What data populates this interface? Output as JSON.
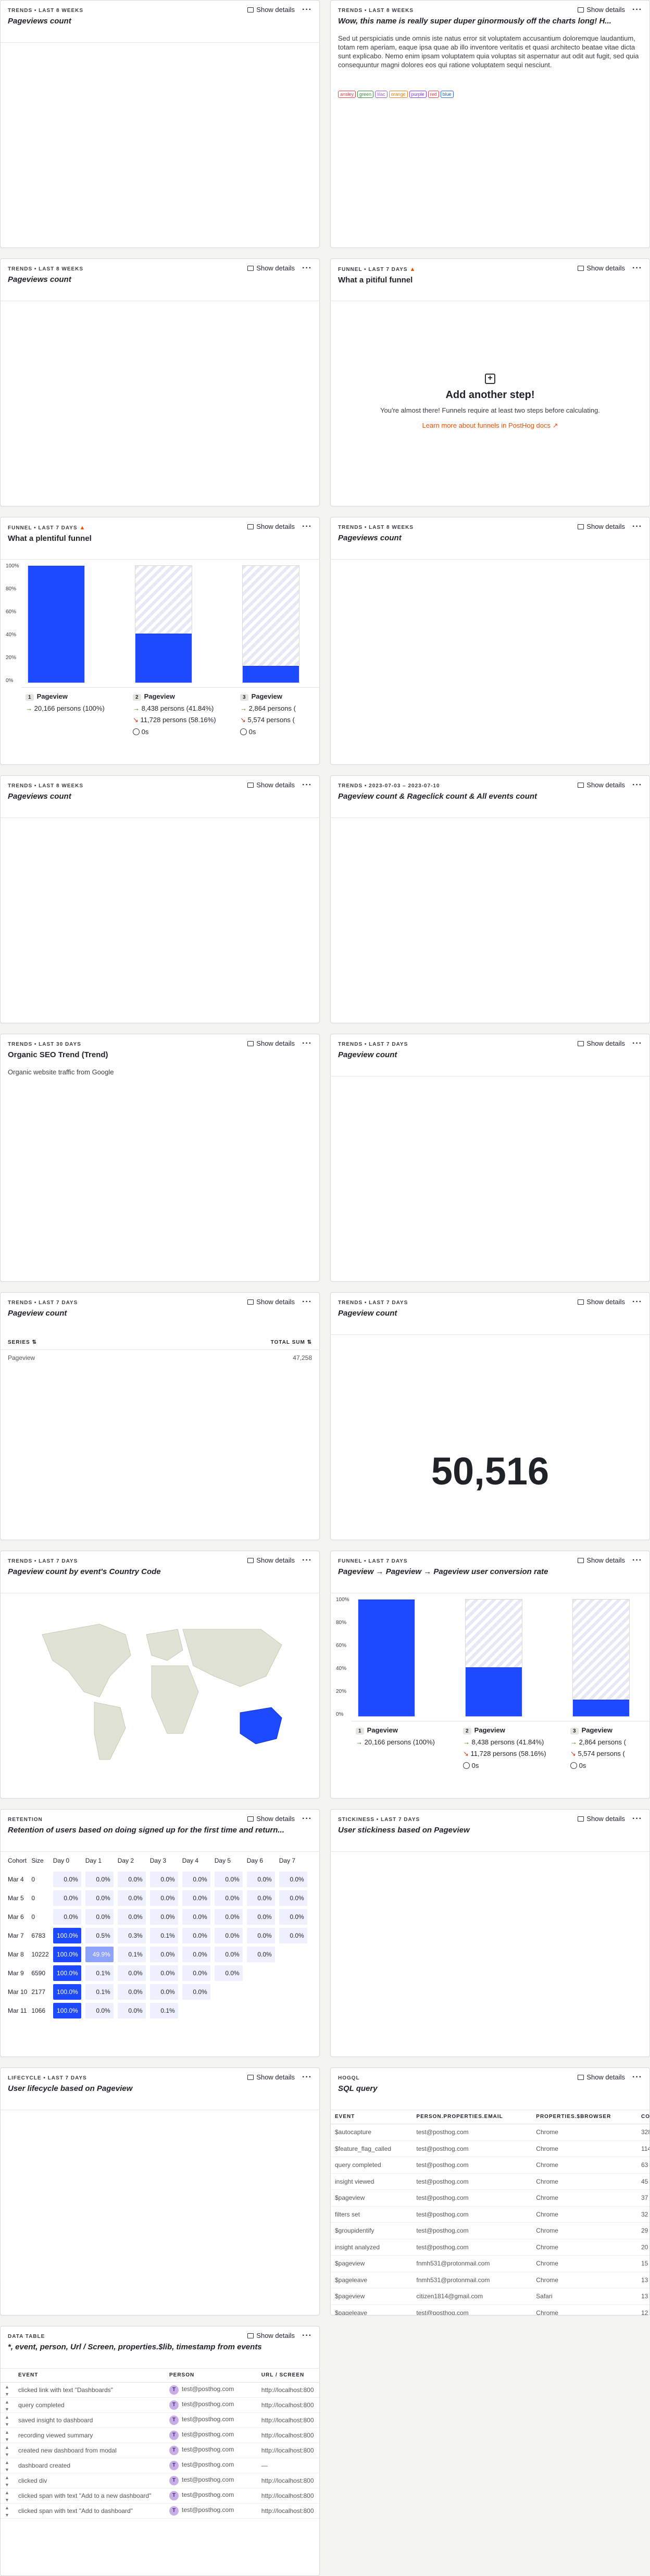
{
  "ui": {
    "show_details": "Show details",
    "more": "···"
  },
  "cards": {
    "c1": {
      "meta": "TRENDS • LAST 8 WEEKS",
      "title": "Pageviews count"
    },
    "c2": {
      "meta": "TRENDS • LAST 8 WEEKS",
      "title": "Wow, this name is really super duper ginormously off the charts long! H...",
      "desc": "Sed ut perspiciatis unde omnis iste natus error sit voluptatem accusantium doloremque laudantium, totam rem aperiam, eaque ipsa quae ab illo inventore veritatis et quasi architecto beatae vitae dicta sunt explicabo. Nemo enim ipsam voluptatem quia voluptas sit aspernatur aut odit aut fugit, sed quia consequuntur magni dolores eos qui ratione voluptatem sequi nesciunt.",
      "tags": [
        {
          "label": "ansley",
          "color": "#e0424b"
        },
        {
          "label": "green",
          "color": "#3a8a3a"
        },
        {
          "label": "lilac",
          "color": "#a15ec9"
        },
        {
          "label": "orange",
          "color": "#e8811d"
        },
        {
          "label": "purple",
          "color": "#7c3aed"
        },
        {
          "label": "red",
          "color": "#e0424b"
        },
        {
          "label": "blue",
          "color": "#2d62d8"
        }
      ]
    },
    "c3": {
      "meta": "TRENDS • LAST 8 WEEKS",
      "title": "Pageviews count"
    },
    "c4": {
      "meta": "FUNNEL • LAST 7 DAYS",
      "title": "What a pitiful funnel",
      "empty_title": "Add another step!",
      "empty_text": "You're almost there! Funnels require at least two steps before calculating.",
      "empty_link": "Learn more about funnels in PostHog docs"
    },
    "c5": {
      "meta": "FUNNEL • LAST 7 DAYS",
      "title": "What a plentiful funnel"
    },
    "c6": {
      "meta": "TRENDS • LAST 8 WEEKS",
      "title": "Pageviews count"
    },
    "c7": {
      "meta": "TRENDS • LAST 8 WEEKS",
      "title": "Pageviews count"
    },
    "c8": {
      "meta": "TRENDS • 2023-07-03 – 2023-07-10",
      "title": "Pageview count & Rageclick count & All events count"
    },
    "c9": {
      "meta": "TRENDS • LAST 30 DAYS",
      "title": "Organic SEO Trend (Trend)",
      "desc": "Organic website traffic from Google"
    },
    "c10": {
      "meta": "TRENDS • LAST 7 DAYS",
      "title": "Pageview count"
    },
    "c11": {
      "meta": "TRENDS • LAST 7 DAYS",
      "title": "Pageview count",
      "col_series": "SERIES",
      "col_total": "TOTAL SUM",
      "row_label": "Pageview",
      "row_value": "47,258"
    },
    "c12": {
      "meta": "TRENDS • LAST 7 DAYS",
      "title": "Pageview count",
      "big_number": "50,516"
    },
    "c13": {
      "meta": "TRENDS • LAST 7 DAYS",
      "title": "Pageview count by event's Country Code"
    },
    "c14": {
      "meta": "FUNNEL • LAST 7 DAYS",
      "title": "Pageview → Pageview → Pageview user conversion rate"
    },
    "c15": {
      "meta": "RETENTION",
      "title": "Retention of users based on doing signed up for the first time and return..."
    },
    "c16": {
      "meta": "STICKINESS • LAST 7 DAYS",
      "title": "User stickiness based on Pageview"
    },
    "c17": {
      "meta": "LIFECYCLE • LAST 7 DAYS",
      "title": "User lifecycle based on Pageview"
    },
    "c18": {
      "meta": "HOGQL",
      "title": "SQL query"
    },
    "c19": {
      "meta": "DATA TABLE",
      "title": "*, event, person, Url / Screen, properties.$lib, timestamp from events"
    }
  },
  "funnel": {
    "y_ticks": [
      "100%",
      "80%",
      "60%",
      "40%",
      "20%",
      "0%"
    ],
    "steps": [
      {
        "num": "1",
        "name": "Pageview",
        "conv_pct": 1.0,
        "line1": "20,166 persons (100%)",
        "line2": "",
        "time": ""
      },
      {
        "num": "2",
        "name": "Pageview",
        "conv_pct": 0.4184,
        "line1": "8,438 persons (41.84%)",
        "line2": "11,728 persons (58.16%)",
        "time": "0s"
      },
      {
        "num": "3",
        "name": "Pageview",
        "conv_pct": 0.142,
        "line1": "2,864 persons (",
        "line2": "5,574 persons (",
        "time": "0s"
      }
    ]
  },
  "retention": {
    "headers": [
      "Cohort",
      "Size",
      "Day 0",
      "Day 1",
      "Day 2",
      "Day 3",
      "Day 4",
      "Day 5",
      "Day 6",
      "Day 7"
    ],
    "rows": [
      {
        "cohort": "Mar 4",
        "size": "0",
        "vals": [
          "0.0%",
          "0.0%",
          "0.0%",
          "0.0%",
          "0.0%",
          "0.0%",
          "0.0%",
          "0.0%"
        ]
      },
      {
        "cohort": "Mar 5",
        "size": "0",
        "vals": [
          "0.0%",
          "0.0%",
          "0.0%",
          "0.0%",
          "0.0%",
          "0.0%",
          "0.0%",
          "0.0%"
        ]
      },
      {
        "cohort": "Mar 6",
        "size": "0",
        "vals": [
          "0.0%",
          "0.0%",
          "0.0%",
          "0.0%",
          "0.0%",
          "0.0%",
          "0.0%",
          "0.0%"
        ]
      },
      {
        "cohort": "Mar 7",
        "size": "6783",
        "vals": [
          "100.0%",
          "0.5%",
          "0.3%",
          "0.1%",
          "0.0%",
          "0.0%",
          "0.0%",
          "0.0%"
        ]
      },
      {
        "cohort": "Mar 8",
        "size": "10222",
        "vals": [
          "100.0%",
          "49.9%",
          "0.1%",
          "0.0%",
          "0.0%",
          "0.0%",
          "0.0%",
          ""
        ]
      },
      {
        "cohort": "Mar 9",
        "size": "6590",
        "vals": [
          "100.0%",
          "0.1%",
          "0.0%",
          "0.0%",
          "0.0%",
          "0.0%",
          "",
          ""
        ]
      },
      {
        "cohort": "Mar 10",
        "size": "2177",
        "vals": [
          "100.0%",
          "0.1%",
          "0.0%",
          "0.0%",
          "0.0%",
          "",
          "",
          ""
        ]
      },
      {
        "cohort": "Mar 11",
        "size": "1066",
        "vals": [
          "100.0%",
          "0.0%",
          "0.0%",
          "0.1%",
          "",
          "",
          "",
          ""
        ]
      }
    ]
  },
  "sql": {
    "headers": [
      "EVENT",
      "PERSON.PROPERTIES.EMAIL",
      "PROPERTIES.$BROWSER",
      "COU"
    ],
    "rows": [
      [
        "$autocapture",
        "test@posthog.com",
        "Chrome",
        "328"
      ],
      [
        "$feature_flag_called",
        "test@posthog.com",
        "Chrome",
        "114"
      ],
      [
        "query completed",
        "test@posthog.com",
        "Chrome",
        "63"
      ],
      [
        "insight viewed",
        "test@posthog.com",
        "Chrome",
        "45"
      ],
      [
        "$pageview",
        "test@posthog.com",
        "Chrome",
        "37"
      ],
      [
        "filters set",
        "test@posthog.com",
        "Chrome",
        "32"
      ],
      [
        "$groupidentify",
        "test@posthog.com",
        "Chrome",
        "29"
      ],
      [
        "insight analyzed",
        "test@posthog.com",
        "Chrome",
        "20"
      ],
      [
        "$pageview",
        "fnmh531@protonmail.com",
        "Chrome",
        "15"
      ],
      [
        "$pageleave",
        "fnmh531@protonmail.com",
        "Chrome",
        "13"
      ],
      [
        "$pageview",
        "citizen1814@gmail.com",
        "Safari",
        "13"
      ],
      [
        "$pageleave",
        "test@posthog.com",
        "Chrome",
        "12"
      ]
    ]
  },
  "datatable": {
    "headers": [
      "EVENT",
      "PERSON",
      "URL / SCREEN"
    ],
    "rows": [
      [
        "clicked link with text \"Dashboards\"",
        "test@posthog.com",
        "http://localhost:800"
      ],
      [
        "query completed",
        "test@posthog.com",
        "http://localhost:800"
      ],
      [
        "saved insight to dashboard",
        "test@posthog.com",
        "http://localhost:800"
      ],
      [
        "recording viewed summary",
        "test@posthog.com",
        "http://localhost:800"
      ],
      [
        "created new dashboard from modal",
        "test@posthog.com",
        "http://localhost:800"
      ],
      [
        "dashboard created",
        "test@posthog.com",
        "—"
      ],
      [
        "clicked div",
        "test@posthog.com",
        "http://localhost:800"
      ],
      [
        "clicked span with text \"Add to a new dashboard\"",
        "test@posthog.com",
        "http://localhost:800"
      ],
      [
        "clicked span with text \"Add to dashboard\"",
        "test@posthog.com",
        "http://localhost:800"
      ]
    ]
  },
  "colors": {
    "primary": "#1d4aff",
    "link": "#f54e00"
  }
}
